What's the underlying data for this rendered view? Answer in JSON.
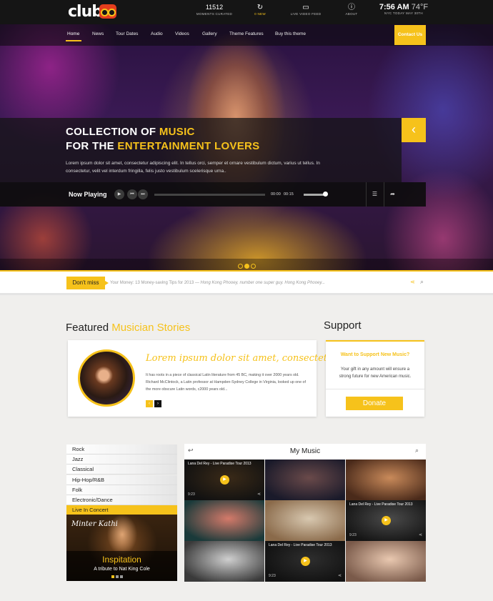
{
  "brand": {
    "name": "club",
    "accent": "#f6c21b"
  },
  "topbar": {
    "items": [
      {
        "big": "11512",
        "small": "MOMENTS CURATED"
      },
      {
        "icon": "refresh-icon",
        "small": "0 NEW"
      },
      {
        "icon": "video-camera-icon",
        "small": "LIVE VIDEO FEED"
      },
      {
        "icon": "info-icon",
        "small": "ABOUT"
      }
    ],
    "clock": {
      "time": "7:56 AM",
      "temp": "74°F",
      "sub": "NYC TODAY MAY 30TH"
    }
  },
  "nav": {
    "items": [
      "Home",
      "News",
      "Tour Dates",
      "Audio",
      "Videos",
      "Gallery",
      "Theme Features",
      "Buy this theme"
    ],
    "contact": "Contact Us"
  },
  "hero": {
    "title_line1_a": "COLLECTION OF ",
    "title_line1_b": "MUSIC",
    "title_line2_a": "FOR THE ",
    "title_line2_b": "ENTERTAINMENT LOVERS",
    "text": "Lorem ipsum dolor sit amet, consectetur adipiscing elit. In tellus orci, semper et ornare vestibulum dictum, varius ut tellus. In consectetur, velit vel interdum fringilla, felis justo vestibulum scelerisque urna..",
    "prev_icon": "chevron-left-icon",
    "slides": 3,
    "active_slide": 2
  },
  "player": {
    "label": "Now Playing",
    "current": "00:00",
    "total": "00:15",
    "progress": 0.0,
    "volume": 0.85
  },
  "ticker": {
    "badge": "Don't miss",
    "text_a": "Your Money: 13 Money-saving Tips for 2013 — ",
    "text_b": "Hong Kong Phooey, number one super guy. Hong Kong Phooey..."
  },
  "featured": {
    "title_a": "Featured ",
    "title_b": "Musician Stories",
    "heading": "Lorem ipsum dolor sit amet, consectetur ...",
    "body": "It has roots in a piece of classical Latin literature from 45 BC, making it over 2000 years old. Richard McClintock, a Latin professor at Hampden-Sydney College in Virginia, looked up one of the more obscure Latin words, c2000 years old...",
    "prev": "‹",
    "next": "›"
  },
  "support": {
    "title": "Support",
    "question": "Want to Support New Music?",
    "text": "Your gift in any amount will ensure a strong future for new American music.",
    "donate": "Donate"
  },
  "genres": {
    "items": [
      "Rock",
      "Jazz",
      "Classical",
      "Hip-Hop/R&B",
      "Folk",
      "Electronic/Dance",
      "Live In Concert"
    ],
    "active": "Live In Concert"
  },
  "concert": {
    "sign": "Minter Kathi",
    "title": "Inspitation",
    "subtitle": "A tribute to Nat King Cole",
    "dots": 3,
    "active_dot": 0
  },
  "my_music": {
    "title": "My Music",
    "tiles": [
      {
        "caption": "Lana Del Rey - Live Paradise Tour 2013",
        "time": "9:23",
        "playable": true,
        "c1": "#3a2a18",
        "c2": "#111"
      },
      {
        "caption": "",
        "time": "",
        "playable": false,
        "c1": "#6a4a4a",
        "c2": "#1a1a2a"
      },
      {
        "caption": "",
        "time": "",
        "playable": false,
        "c1": "#c98a5a",
        "c2": "#4a2a1a"
      },
      {
        "caption": "",
        "time": "",
        "playable": false,
        "c1": "#d47a6a",
        "c2": "#1a3a3a"
      },
      {
        "caption": "",
        "time": "",
        "playable": false,
        "c1": "#d8c8b0",
        "c2": "#8a6a4a"
      },
      {
        "caption": "Lana Del Rey - Live Paradise Tour 2013",
        "time": "9:23",
        "playable": true,
        "c1": "#4a4a4a",
        "c2": "#151515"
      },
      {
        "caption": "",
        "time": "",
        "playable": false,
        "c1": "#cfcfcf",
        "c2": "#3a3a3a"
      },
      {
        "caption": "Lana Del Rey - Live Paradise Tour 2013",
        "time": "9:23",
        "playable": true,
        "c1": "#2e2e2e",
        "c2": "#111"
      },
      {
        "caption": "",
        "time": "",
        "playable": false,
        "c1": "#e9c8b0",
        "c2": "#7a5a4a"
      }
    ]
  }
}
